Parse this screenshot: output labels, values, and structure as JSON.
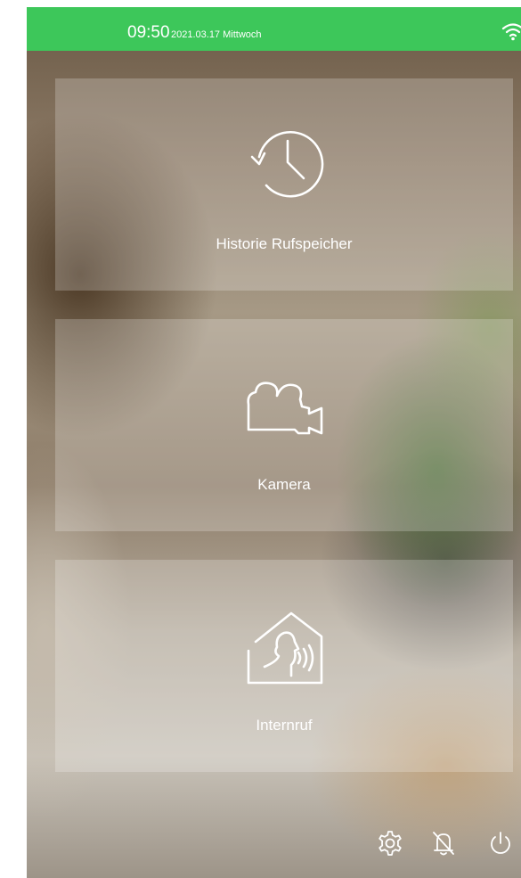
{
  "status_bar": {
    "time": "09:50",
    "date": "2021.03.17 Mittwoch",
    "wifi_icon": "wifi-icon",
    "color": "#3dc75a"
  },
  "cards": [
    {
      "label": "Historie Rufspeicher",
      "icon": "history-clock-icon"
    },
    {
      "label": "Kamera",
      "icon": "video-camera-icon"
    },
    {
      "label": "Internruf",
      "icon": "house-intercom-icon"
    }
  ],
  "bottom_bar": {
    "settings_icon": "gear-icon",
    "mute_icon": "bell-off-icon",
    "power_icon": "power-icon"
  }
}
